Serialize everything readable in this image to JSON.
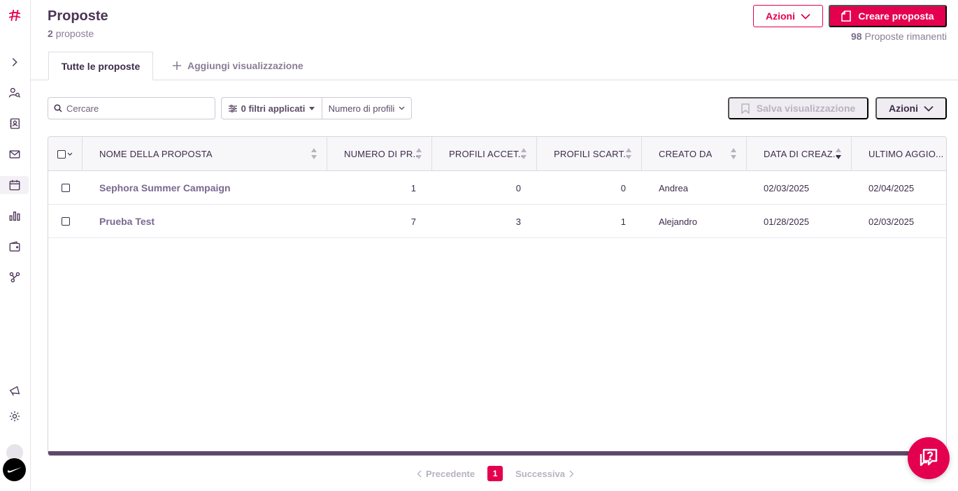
{
  "header": {
    "title": "Proposte",
    "count": "2",
    "count_label": "proposte",
    "actions_label": "Azioni",
    "create_label": "Creare proposta",
    "remaining_count": "98",
    "remaining_label": "Proposte rimanenti"
  },
  "tabs": {
    "active": "Tutte le proposte",
    "add": "Aggiungi visualizzazione"
  },
  "toolbar": {
    "search_placeholder": "Cercare",
    "filters_label": "0 filtri applicati",
    "profiles_label": "Numero di profili",
    "save_view_label": "Salva visualizzazione",
    "actions_label": "Azioni"
  },
  "table": {
    "columns": [
      "NOME DELLA PROPOSTA",
      "NUMERO DI PR...",
      "PROFILI ACCET...",
      "PROFILI SCART...",
      "CREATO DA",
      "DATA DI CREAZ...",
      "ULTIMO AGGIO..."
    ],
    "rows": [
      {
        "name": "Sephora Summer Campaign",
        "profiles": "1",
        "accepted": "0",
        "discarded": "0",
        "created_by": "Andrea",
        "created_on": "02/03/2025",
        "updated_on": "02/04/2025"
      },
      {
        "name": "Prueba Test",
        "profiles": "7",
        "accepted": "3",
        "discarded": "1",
        "created_by": "Alejandro",
        "created_on": "01/28/2025",
        "updated_on": "02/03/2025"
      }
    ]
  },
  "pagination": {
    "prev": "Precedente",
    "current": "1",
    "next": "Successiva"
  },
  "colors": {
    "brand": "#e4004f",
    "text": "#3d2c4a"
  },
  "icons": [
    "logo-hash-icon",
    "expand-chevron-icon",
    "user-search-icon",
    "contacts-icon",
    "mail-icon",
    "calendar-icon",
    "bar-chart-icon",
    "wallet-icon",
    "network-icon",
    "megaphone-icon",
    "gear-icon",
    "help-chat-icon"
  ]
}
